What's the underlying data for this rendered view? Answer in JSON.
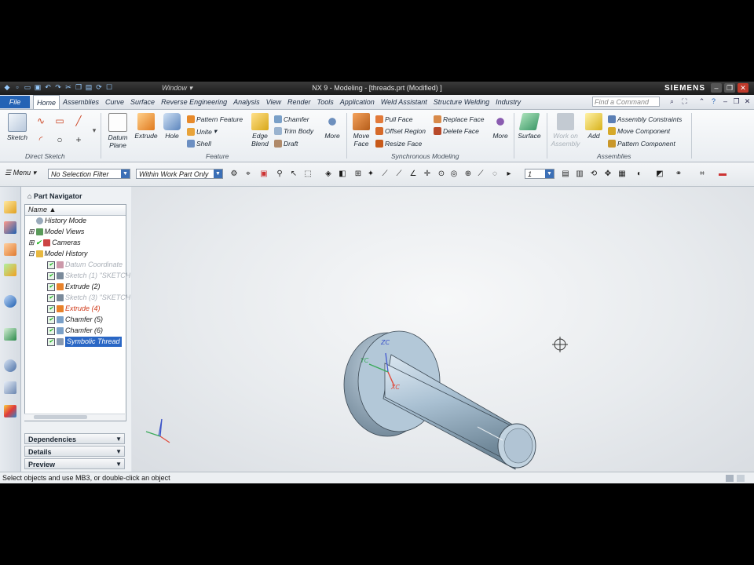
{
  "window": {
    "menu_label": "Window",
    "title": "NX 9 - Modeling - [threads.prt (Modified) ]",
    "brand": "SIEMENS"
  },
  "menubar": {
    "file": "File",
    "tabs": [
      "Home",
      "Assemblies",
      "Curve",
      "Surface",
      "Reverse Engineering",
      "Analysis",
      "View",
      "Render",
      "Tools",
      "Application",
      "Weld Assistant",
      "Structure Welding",
      "Industry"
    ],
    "active_tab": "Home",
    "find_placeholder": "Find a Command"
  },
  "ribbon": {
    "direct_sketch": {
      "label": "Direct Sketch",
      "sketch": "Sketch"
    },
    "feature": {
      "label": "Feature",
      "datum_plane": "Datum Plane",
      "extrude": "Extrude",
      "hole": "Hole",
      "pattern_feature": "Pattern Feature",
      "unite": "Unite",
      "shell": "Shell",
      "edge_blend": "Edge Blend",
      "chamfer": "Chamfer",
      "trim_body": "Trim Body",
      "draft": "Draft",
      "more": "More"
    },
    "synchronous": {
      "label": "Synchronous Modeling",
      "move_face": "Move Face",
      "pull_face": "Pull Face",
      "offset_region": "Offset Region",
      "resize_face": "Resize Face",
      "replace_face": "Replace Face",
      "delete_face": "Delete Face",
      "more": "More"
    },
    "surface": {
      "label": "Surface"
    },
    "assemblies": {
      "label": "Assemblies",
      "work_on_assembly": "Work on Assembly",
      "add": "Add",
      "assembly_constraints": "Assembly Constraints",
      "move_component": "Move Component",
      "pattern_component": "Pattern Component"
    }
  },
  "selection_toolbar": {
    "menu": "Menu",
    "filter": "No Selection Filter",
    "scope": "Within Work Part Only",
    "layer": "1"
  },
  "navigator": {
    "title": "Part Navigator",
    "column": "Name",
    "nodes": [
      {
        "label": "History Mode"
      },
      {
        "label": "Model Views"
      },
      {
        "label": "Cameras"
      },
      {
        "label": "Model History"
      },
      {
        "label": "Datum Coordinate"
      },
      {
        "label": "Sketch (1) \"SKETCH"
      },
      {
        "label": "Extrude (2)"
      },
      {
        "label": "Sketch (3) \"SKETCH"
      },
      {
        "label": "Extrude (4)"
      },
      {
        "label": "Chamfer (5)"
      },
      {
        "label": "Chamfer (6)"
      },
      {
        "label": "Symbolic Thread"
      }
    ],
    "panels": [
      "Dependencies",
      "Details",
      "Preview"
    ]
  },
  "viewport": {
    "axes": {
      "zc": "ZC",
      "yc": "YC",
      "xc": "XC"
    }
  },
  "status": "Select objects and use MB3, or double-click an object",
  "colors": {
    "accent": "#2463b5",
    "selection": "#2a67c5",
    "error": "#d03a1a",
    "model": "#a9c0d2"
  }
}
